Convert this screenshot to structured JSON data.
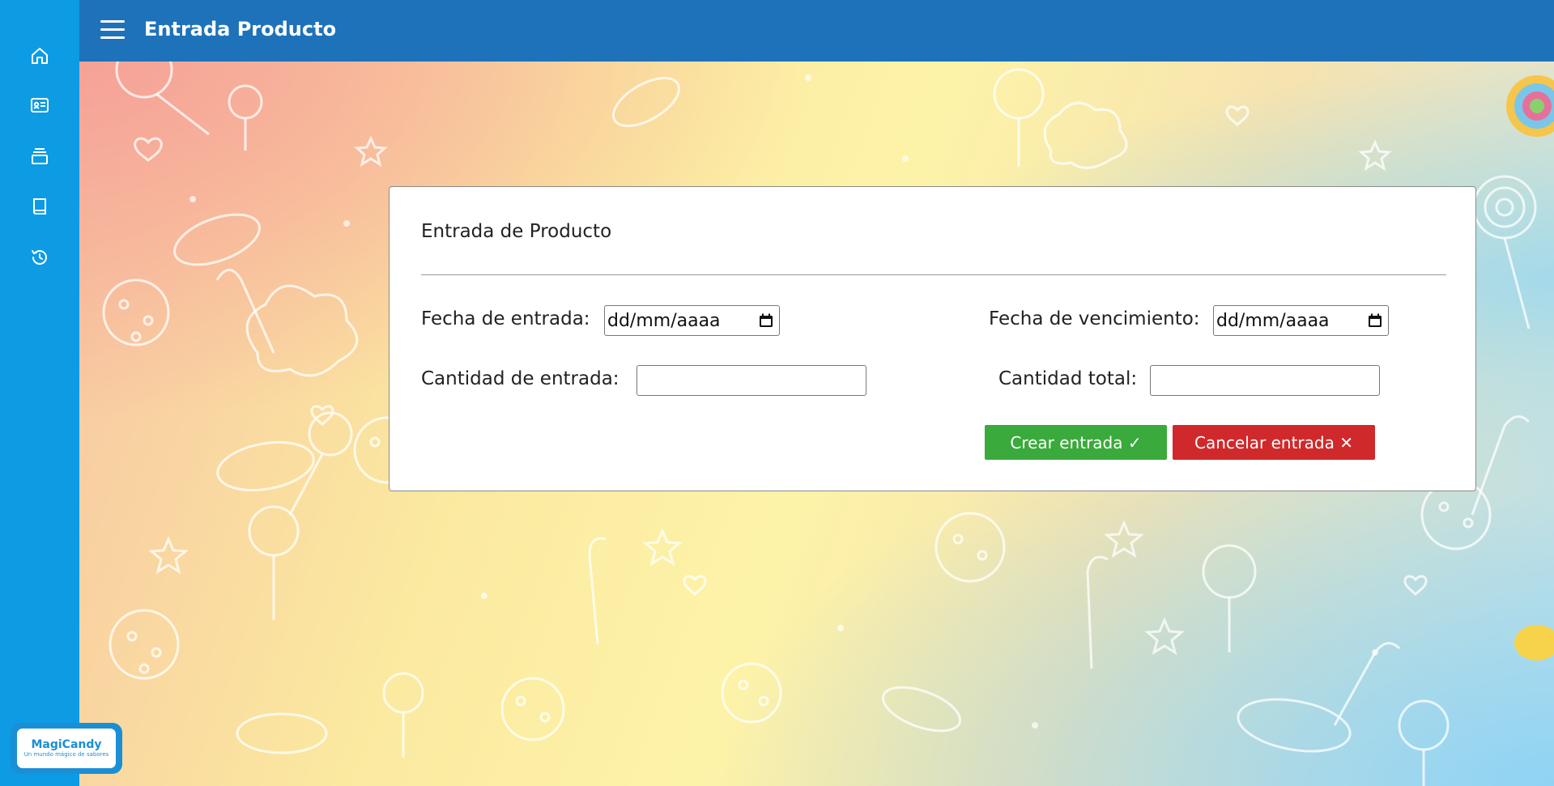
{
  "header": {
    "title": "Entrada Producto"
  },
  "sidebar": {
    "items": [
      {
        "icon": "home-icon"
      },
      {
        "icon": "id-card-icon"
      },
      {
        "icon": "stack-icon"
      },
      {
        "icon": "book-icon"
      },
      {
        "icon": "history-icon"
      }
    ],
    "logo": {
      "name": "MagiCandy",
      "tagline": "Un mundo mágico de sabores"
    }
  },
  "form": {
    "title": "Entrada de Producto",
    "fecha_entrada": {
      "label": "Fecha de entrada:",
      "value": "dd/mm/aaaa"
    },
    "fecha_vencimiento": {
      "label": "Fecha de vencimiento:",
      "value": "dd/mm/aaaa"
    },
    "cantidad_entrada": {
      "label": "Cantidad de entrada:",
      "value": ""
    },
    "cantidad_total": {
      "label": "Cantidad total:",
      "value": ""
    },
    "create_button": "Crear entrada ✓",
    "cancel_button": "Cancelar entrada ✕"
  },
  "colors": {
    "sidebar": "#0d9be4",
    "topbar": "#1e72ba",
    "create": "#3aaa3c",
    "cancel": "#d0292b"
  }
}
